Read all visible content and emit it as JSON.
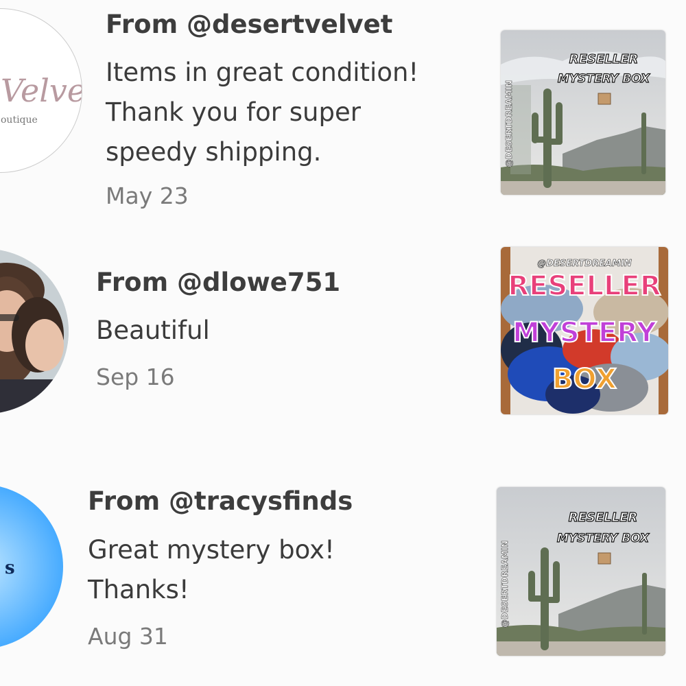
{
  "reviews": [
    {
      "from": "From @desertvelvet",
      "lines": [
        "Items in great condition!",
        "Thank you for super",
        "speedy shipping."
      ],
      "date": "May 23",
      "avatar_text": "Velvet",
      "avatar_subtext": "outique",
      "thumb": {
        "style": "desert",
        "title1": "RESELLER",
        "title2": "MYSTERY BOX",
        "side": "@DESERTDREAMIN"
      }
    },
    {
      "from": "From @dlowe751",
      "lines": [
        "Beautiful"
      ],
      "date": "Sep 16",
      "thumb": {
        "style": "clothes",
        "handle": "@DESERTDREAMIN",
        "word1": "RESELLER",
        "word2": "MYSTERY",
        "word3": "BOX"
      }
    },
    {
      "from": "From @tracysfinds",
      "lines": [
        "Great mystery box!",
        "Thanks!"
      ],
      "date": "Aug 31",
      "avatar_text": "s",
      "thumb": {
        "style": "desert",
        "title1": "RESELLER",
        "title2": "MYSTERY BOX",
        "side": "@DESERTDREAMIN"
      }
    }
  ]
}
